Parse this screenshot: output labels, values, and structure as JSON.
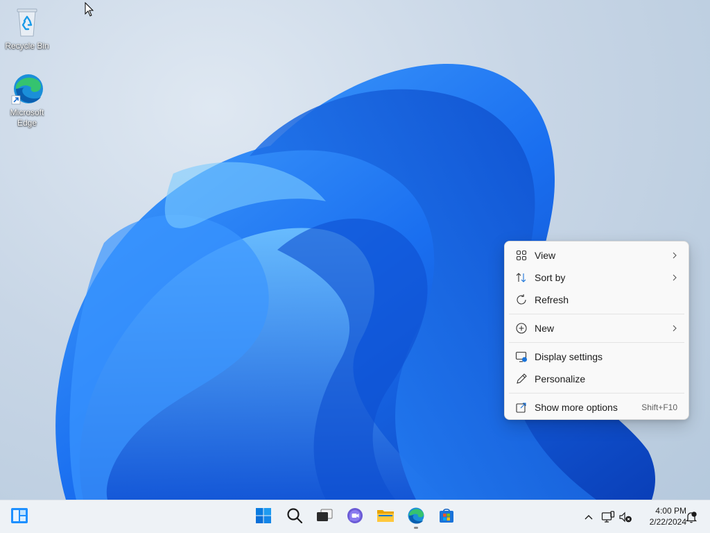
{
  "desktop": {
    "icons": [
      {
        "label": "Recycle Bin",
        "icon": "recycle-bin-icon"
      },
      {
        "label": "Microsoft Edge",
        "icon": "edge-icon"
      }
    ]
  },
  "context_menu": {
    "items": [
      {
        "label": "View",
        "icon": "grid-view-icon",
        "submenu": true
      },
      {
        "label": "Sort by",
        "icon": "sort-icon",
        "submenu": true
      },
      {
        "label": "Refresh",
        "icon": "refresh-icon",
        "submenu": false
      },
      {
        "label": "New",
        "icon": "plus-circle-icon",
        "submenu": true
      },
      {
        "label": "Display settings",
        "icon": "display-settings-icon",
        "submenu": false
      },
      {
        "label": "Personalize",
        "icon": "pen-icon",
        "submenu": false
      },
      {
        "label": "Show more options",
        "icon": "share-more-icon",
        "shortcut": "Shift+F10"
      }
    ]
  },
  "taskbar": {
    "apps": [
      {
        "name": "Widgets",
        "icon": "widgets-icon"
      },
      {
        "name": "Start",
        "icon": "windows-start-icon"
      },
      {
        "name": "Search",
        "icon": "search-icon"
      },
      {
        "name": "Task View",
        "icon": "task-view-icon"
      },
      {
        "name": "Chat",
        "icon": "teams-chat-icon"
      },
      {
        "name": "File Explorer",
        "icon": "folder-icon"
      },
      {
        "name": "Microsoft Edge",
        "icon": "edge-icon",
        "active": true
      },
      {
        "name": "Microsoft Store",
        "icon": "store-icon"
      }
    ],
    "tray": {
      "time": "4:00 PM",
      "date": "2/22/2024"
    }
  },
  "colors": {
    "accent": "#0067c0",
    "wallpaper_blue": "#1a6ff0",
    "taskbar_bg": "#eef2f6",
    "menu_bg": "#f9f9f9"
  }
}
